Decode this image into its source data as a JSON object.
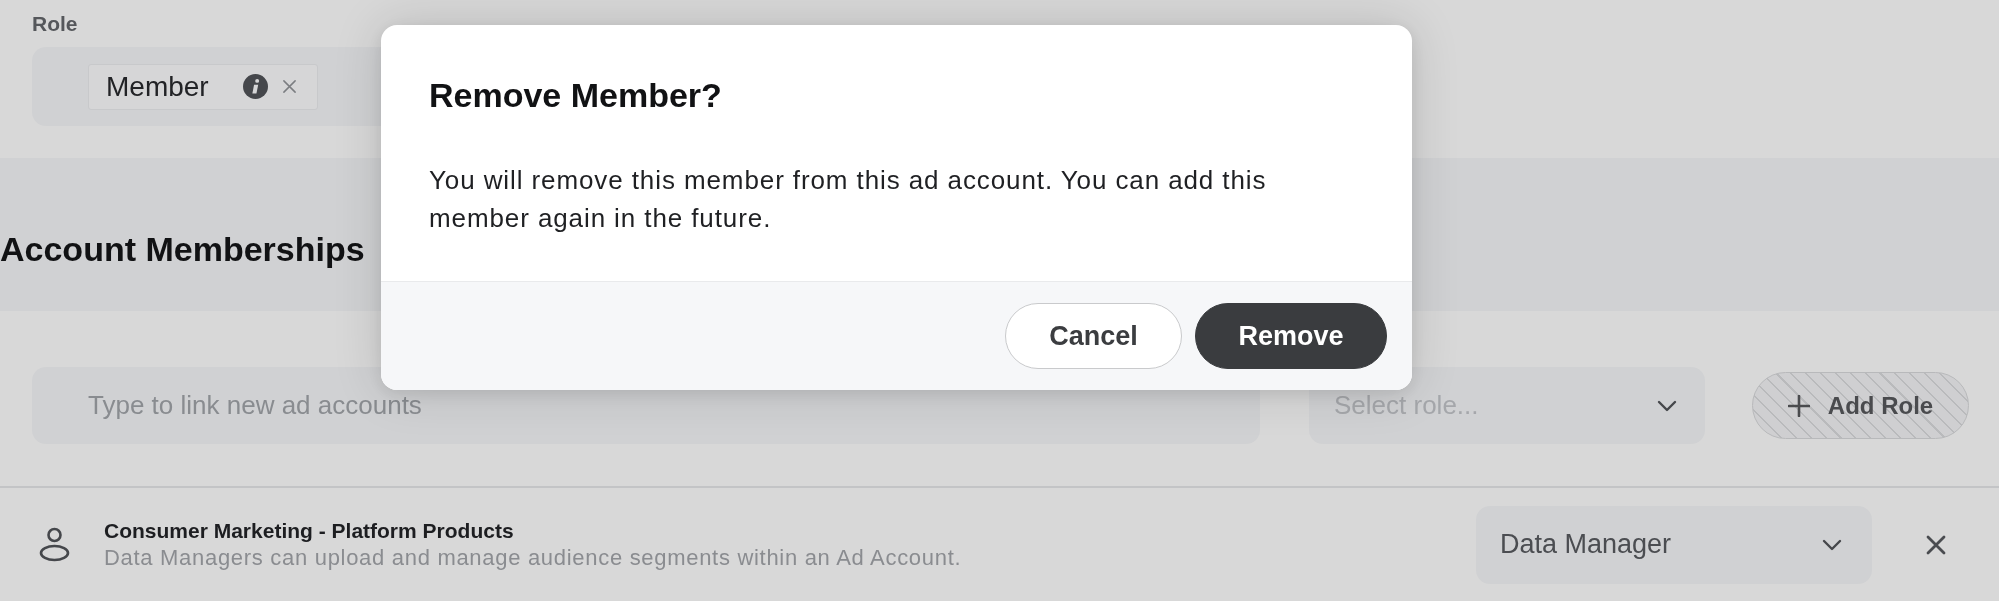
{
  "role_section": {
    "label": "Role",
    "chips": [
      {
        "label": "Member"
      }
    ]
  },
  "memberships_section": {
    "title": "Account Memberships",
    "account_input": {
      "placeholder": "Type to link new ad accounts"
    },
    "role_select": {
      "placeholder": "Select role..."
    },
    "add_role_button": {
      "label": "Add Role",
      "disabled": true
    },
    "memberships": [
      {
        "name": "Consumer Marketing - Platform Products",
        "description": "Data Managers can upload and manage audience segments within an Ad Account.",
        "role": "Data Manager"
      }
    ]
  },
  "dialog": {
    "title": "Remove Member?",
    "message": "You will remove this member from this ad account. You can add this member again in the future.",
    "buttons": [
      {
        "label": "Cancel",
        "kind": "secondary"
      },
      {
        "label": "Remove",
        "kind": "primary"
      }
    ]
  }
}
